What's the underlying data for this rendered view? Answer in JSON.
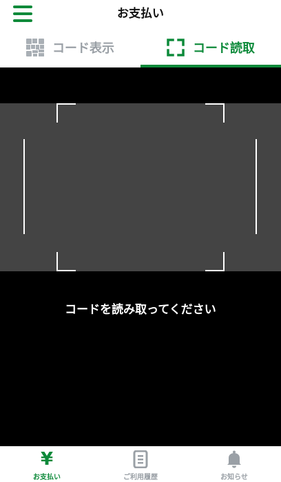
{
  "header": {
    "title": "お支払い"
  },
  "tabs": [
    {
      "label": "コード表示",
      "icon": "qr-code-icon",
      "active": false
    },
    {
      "label": "コード読取",
      "icon": "scan-frame-icon",
      "active": true
    }
  ],
  "scanner": {
    "instruction": "コードを読み取ってください"
  },
  "bottom_nav": [
    {
      "label": "お支払い",
      "icon": "yen-icon",
      "active": true
    },
    {
      "label": "ご利用履歴",
      "icon": "history-icon",
      "active": false
    },
    {
      "label": "お知らせ",
      "icon": "bell-icon",
      "active": false
    }
  ],
  "colors": {
    "accent": "#0d8a3a",
    "inactive": "#9aa0a6",
    "scan_area": "#444444",
    "background": "#000000"
  }
}
